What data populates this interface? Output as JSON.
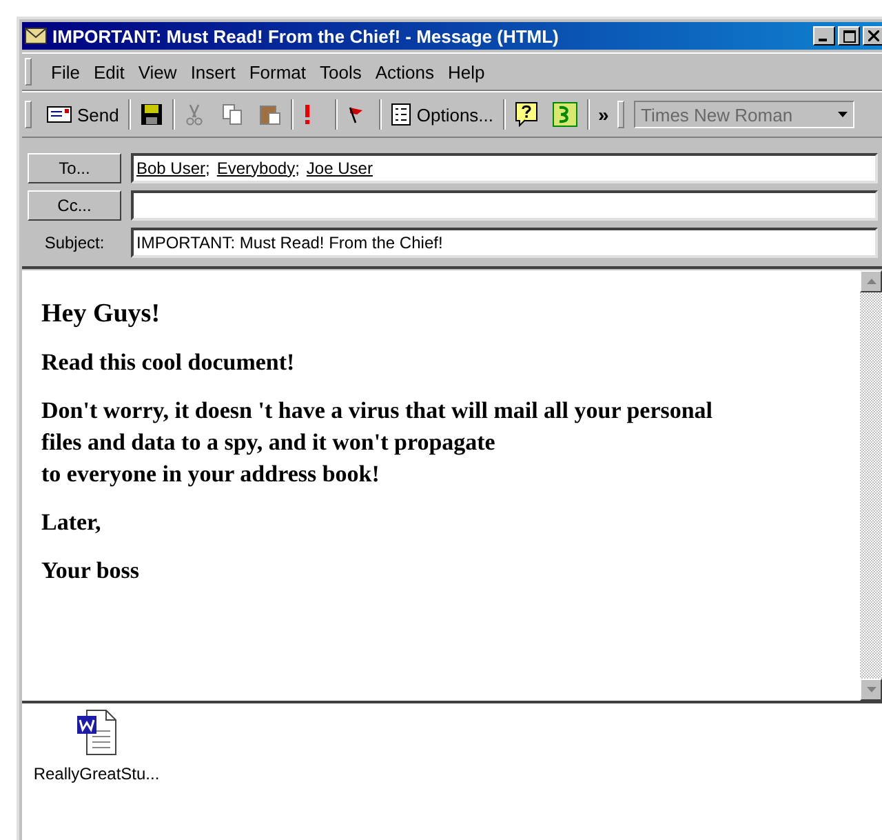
{
  "window": {
    "title": "IMPORTANT: Must Read! From the Chief! - Message (HTML)"
  },
  "menu": [
    "File",
    "Edit",
    "View",
    "Insert",
    "Format",
    "Tools",
    "Actions",
    "Help"
  ],
  "toolbar": [
    {
      "kind": "send",
      "label": "Send"
    },
    {
      "kind": "save"
    },
    {
      "kind": "cut",
      "disabled": true
    },
    {
      "kind": "copy",
      "disabled": true
    },
    {
      "kind": "paste",
      "disabled": true
    },
    {
      "kind": "importance"
    },
    {
      "kind": "flag"
    },
    {
      "kind": "options",
      "label": "Options..."
    },
    {
      "kind": "help"
    },
    {
      "kind": "address"
    },
    {
      "kind": "more",
      "label": "»"
    }
  ],
  "font_box": {
    "value": "Times New Roman",
    "disabled": true
  },
  "header": {
    "to_button": "To...",
    "to": [
      "Bob User",
      "Everybody",
      "Joe User"
    ],
    "to_separator": ";",
    "cc_button": "Cc...",
    "subject_label": "Subject:",
    "subject": "IMPORTANT: Must Read! From the Chief!"
  },
  "body": [
    [
      "Hey Guys!"
    ],
    [
      "Read this cool document!"
    ],
    [
      "Don't worry, it doesn 't have a virus that will mail all your personal",
      "files and data to a spy, and it won't propagate",
      "to everyone in your address book!"
    ],
    [
      "Later,"
    ],
    [
      "Your boss"
    ]
  ],
  "attachments": [
    {
      "name": "ReallyGreatStu..."
    }
  ]
}
